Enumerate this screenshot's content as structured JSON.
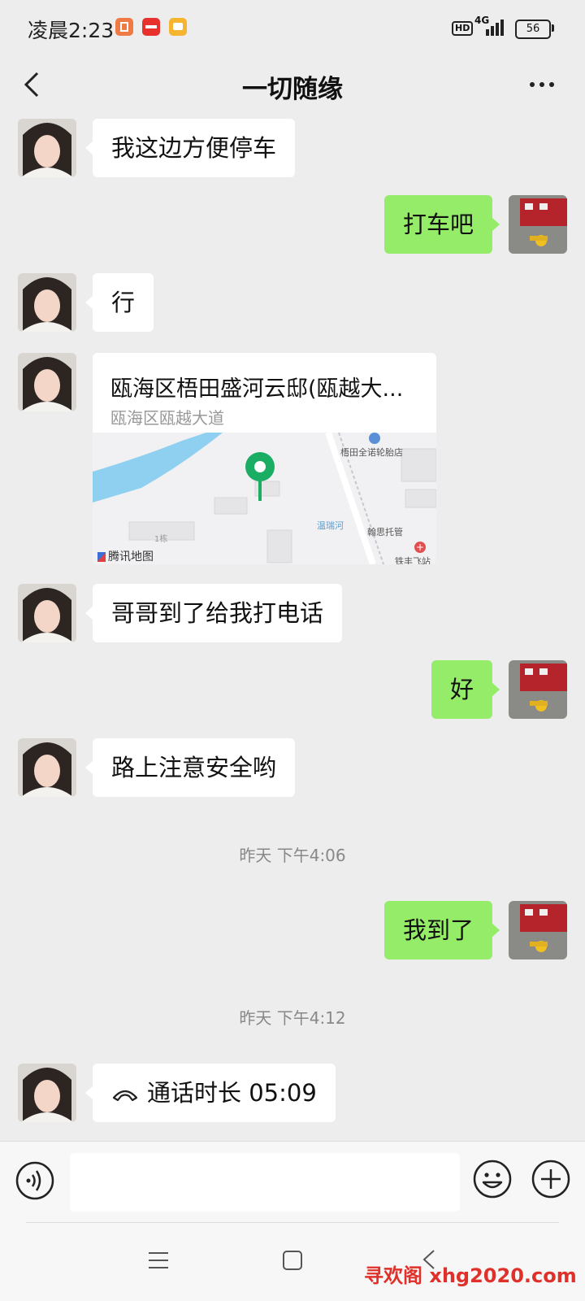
{
  "status_bar": {
    "time": "凌晨2:23",
    "network": "4G",
    "hd": "HD",
    "battery": "56",
    "notification_icons": [
      "orange-square-icon",
      "red-app-icon",
      "yellow-message-icon"
    ]
  },
  "header": {
    "title": "一切随缘",
    "back_icon": "chevron-left-icon",
    "more_icon": "more-dots-icon"
  },
  "messages": [
    {
      "side": "left",
      "type": "text",
      "text": "我这边方便停车"
    },
    {
      "side": "right",
      "type": "text",
      "text": "打车吧"
    },
    {
      "side": "left",
      "type": "text",
      "text": "行"
    },
    {
      "side": "left",
      "type": "location",
      "title": "瓯海区梧田盛河云邸(瓯越大...",
      "subtitle": "瓯海区瓯越大道",
      "map_labels": [
        "梧田全诺轮胎店",
        "温瑞河",
        "翰思托管",
        "1栋",
        "铁丰飞站"
      ],
      "map_provider": "腾讯地图"
    },
    {
      "side": "left",
      "type": "text",
      "text": "哥哥到了给我打电话"
    },
    {
      "side": "right",
      "type": "text",
      "text": "好"
    },
    {
      "side": "left",
      "type": "text",
      "text": "路上注意安全哟"
    },
    {
      "type": "timestamp",
      "text": "昨天 下午4:06"
    },
    {
      "side": "right",
      "type": "text",
      "text": "我到了"
    },
    {
      "type": "timestamp",
      "text": "昨天 下午4:12"
    },
    {
      "side": "left",
      "type": "call",
      "text": "通话时长 05:09",
      "icon": "phone-hangup-icon"
    }
  ],
  "input_bar": {
    "voice_icon": "voice-icon",
    "emoji_icon": "emoji-icon",
    "add_icon": "plus-circle-icon",
    "input_value": ""
  },
  "system_nav": {
    "icons": [
      "menu-icon",
      "home-square-icon",
      "back-chevron-icon"
    ]
  },
  "watermark": "寻欢阁 xhg2020.com",
  "colors": {
    "background": "#ededed",
    "sent_bubble": "#95ec69",
    "received_bubble": "#ffffff",
    "map_pin": "#1aad63",
    "watermark": "#e0302a"
  }
}
